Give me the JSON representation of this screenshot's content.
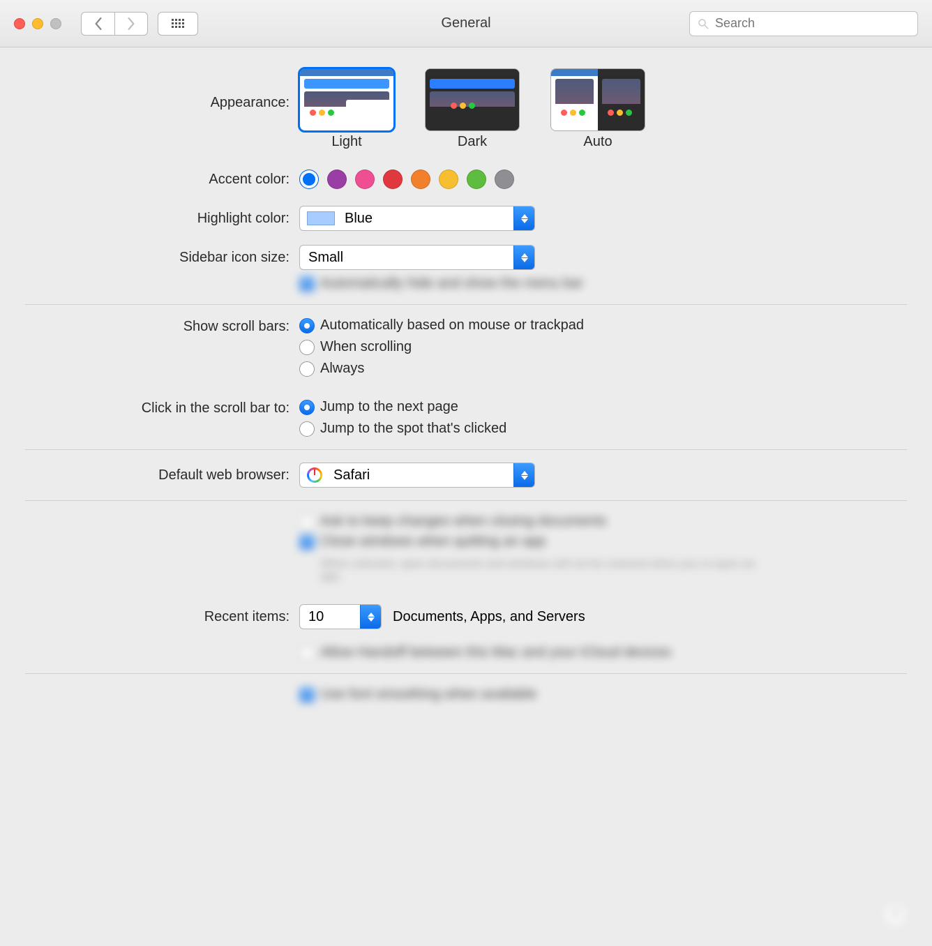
{
  "title": "General",
  "search": {
    "placeholder": "Search"
  },
  "labels": {
    "appearance": "Appearance:",
    "accent": "Accent color:",
    "highlight": "Highlight color:",
    "sidebar": "Sidebar icon size:",
    "scrollbars": "Show scroll bars:",
    "clickscroll": "Click in the scroll bar to:",
    "browser": "Default web browser:",
    "recent": "Recent items:",
    "recentSuffix": "Documents, Apps, and Servers"
  },
  "appearance": {
    "options": {
      "light": "Light",
      "dark": "Dark",
      "auto": "Auto"
    },
    "selected": "light"
  },
  "accentColors": [
    "#0070f6",
    "#9a3ea6",
    "#ef4e93",
    "#e0383e",
    "#f27f2c",
    "#f7bf2f",
    "#5ebd3e",
    "#8e8e93"
  ],
  "accentSelected": 0,
  "highlight": {
    "value": "Blue",
    "swatch": "#a6cdfd"
  },
  "sidebarSize": {
    "value": "Small"
  },
  "menubarHide": {
    "label": "Automatically hide and show the menu bar",
    "checked": false
  },
  "scrollbars": {
    "options": [
      "Automatically based on mouse or trackpad",
      "When scrolling",
      "Always"
    ],
    "selected": 0
  },
  "clickScroll": {
    "options": [
      "Jump to the next page",
      "Jump to the spot that's clicked"
    ],
    "selected": 0
  },
  "browser": {
    "value": "Safari"
  },
  "askKeep": {
    "label": "Ask to keep changes when closing documents",
    "checked": false
  },
  "closeWin": {
    "label": "Close windows when quitting an app",
    "note": "When selected, open documents and windows will not be restored when you re-open an app.",
    "checked": true
  },
  "recent": {
    "value": "10"
  },
  "handoff": {
    "label": "Allow Handoff between this Mac and your iCloud devices",
    "checked": false
  },
  "fontSmooth": {
    "label": "Use font smoothing when available",
    "checked": true
  }
}
